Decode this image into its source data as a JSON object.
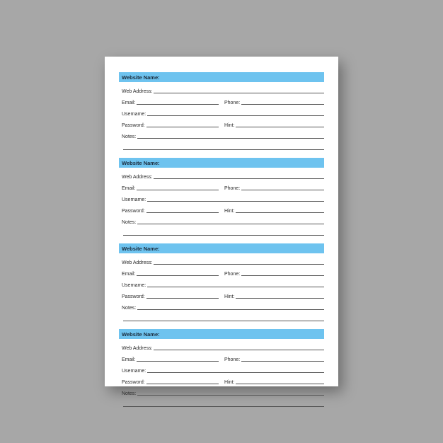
{
  "entry": {
    "title": "Website Name:",
    "web_address": "Web Address:",
    "email": "Email:",
    "phone": "Phone:",
    "username": "Username:",
    "password": "Password:",
    "hint": "Hint:",
    "notes": "Notes:"
  },
  "colors": {
    "accent": "#6ec3ef",
    "background": "#a7a7a7"
  },
  "entry_count": 4
}
